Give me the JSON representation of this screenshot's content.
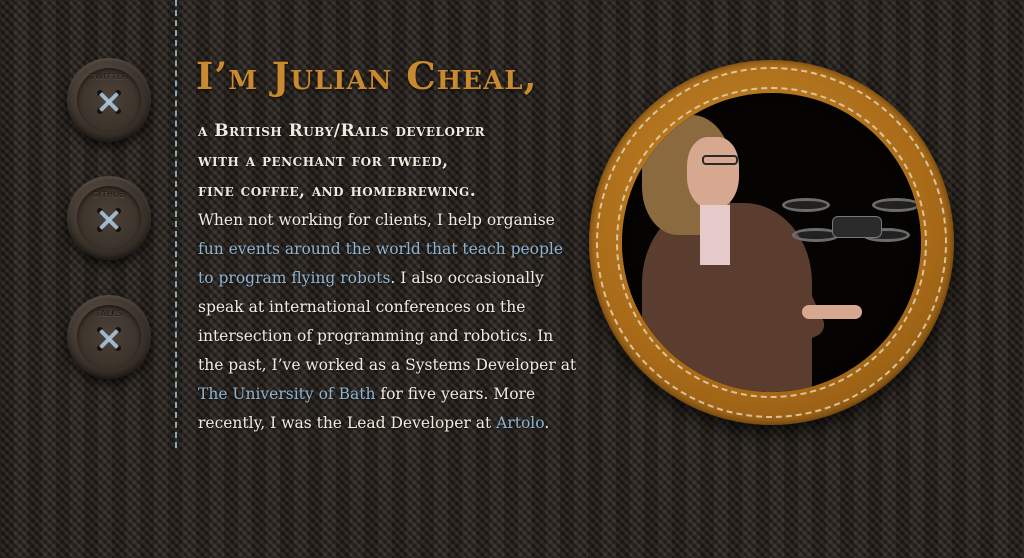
{
  "buttons": [
    {
      "label": "TWITTER"
    },
    {
      "label": "GITHUB"
    },
    {
      "label": "TALKS"
    }
  ],
  "heading": "I’m Julian Cheal,",
  "subtitle": [
    "a British Ruby/Rails developer",
    "with a penchant for tweed,",
    "fine coffee, and homebrewing."
  ],
  "bio": {
    "part1": "When not working for clients, I help organise ",
    "link_events": "fun events around the world that teach people to program flying robots",
    "part2": ". I also occasionally speak at international conferences on the intersection of programming and robotics. In the past, I’ve worked as a Systems Developer at ",
    "link_bath": "The University of Bath",
    "part3": " for five years. More recently, I was the Lead Developer at ",
    "link_artolo": "Artolo",
    "part4": "."
  },
  "colors": {
    "heading": "#c9892e",
    "link": "#8fb3d0",
    "stitch": "#9fbfd6",
    "ring": "#a86a18"
  },
  "portrait": {
    "icon": "portrait-photo-icon"
  }
}
